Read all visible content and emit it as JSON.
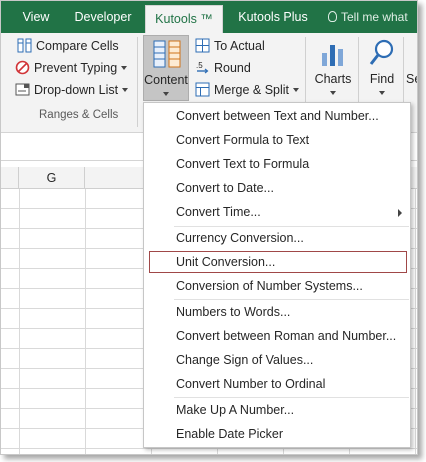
{
  "tabs": [
    {
      "label": "View",
      "active": false
    },
    {
      "label": "Developer",
      "active": false
    },
    {
      "label": "Kutools ™",
      "active": true
    },
    {
      "label": "Kutools Plus",
      "active": false
    }
  ],
  "tell_me": "Tell me what",
  "ribbon": {
    "group_items": {
      "compare": "Compare Cells",
      "prevent": "Prevent Typing",
      "dropdown": "Drop-down List"
    },
    "group_label": "Ranges & Cells",
    "content": "Content",
    "to_actual": "To Actual",
    "round": "Round",
    "merge": "Merge & Split",
    "charts": "Charts",
    "find": "Find",
    "partial": "Se"
  },
  "grid": {
    "column": "G"
  },
  "menu": {
    "items": [
      "Convert between Text and Number...",
      "Convert Formula to Text",
      "Convert Text to Formula",
      "Convert to Date...",
      "Convert Time...",
      "Currency Conversion...",
      "Unit Conversion...",
      "Conversion of Number Systems...",
      "Numbers to Words...",
      "Convert between Roman and Number...",
      "Change Sign of Values...",
      "Convert Number to Ordinal",
      "Make Up A Number...",
      "Enable Date Picker"
    ],
    "highlighted": "Unit Conversion..."
  },
  "colors": {
    "accent": "#217346",
    "highlight_border": "#a04848"
  }
}
